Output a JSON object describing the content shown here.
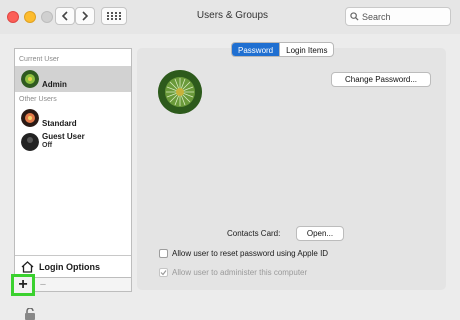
{
  "window": {
    "title": "Users & Groups",
    "search_placeholder": "Search"
  },
  "sidebar": {
    "current_user_heading": "Current User",
    "current_user": {
      "name": "Admin"
    },
    "other_users_heading": "Other Users",
    "other_users": [
      {
        "name": "Standard",
        "status": ""
      },
      {
        "name": "Guest User",
        "status": "Off"
      }
    ],
    "login_options_label": "Login Options",
    "add_button": "+",
    "remove_button": "−"
  },
  "tabs": [
    {
      "label": "Password",
      "active": true
    },
    {
      "label": "Login Items",
      "active": false
    }
  ],
  "main": {
    "change_password_button": "Change Password...",
    "contacts_card_label": "Contacts Card:",
    "open_button": "Open...",
    "options": [
      {
        "label": "Allow user to reset password using Apple ID",
        "checked": false,
        "enabled": true
      },
      {
        "label": "Allow user to administer this computer",
        "checked": true,
        "enabled": false
      }
    ]
  },
  "colors": {
    "accent": "#1f6fd1",
    "highlight_box": "#3bd12f",
    "close": "#fc5f57",
    "minimize": "#fdbc2e"
  }
}
